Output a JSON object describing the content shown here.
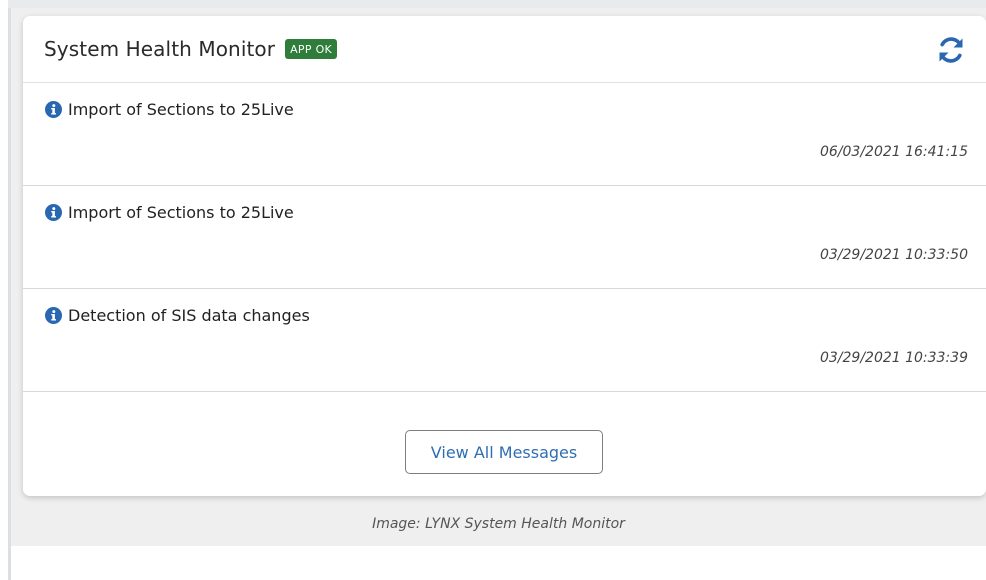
{
  "widget": {
    "title": "System Health Monitor",
    "status_badge": "APP OK",
    "refresh_icon": "refresh-icon"
  },
  "messages": [
    {
      "icon": "info-icon",
      "title": "Import of Sections to 25Live",
      "timestamp": "06/03/2021 16:41:15"
    },
    {
      "icon": "info-icon",
      "title": "Import of Sections to 25Live",
      "timestamp": "03/29/2021 10:33:50"
    },
    {
      "icon": "info-icon",
      "title": "Detection of SIS data changes",
      "timestamp": "03/29/2021 10:33:39"
    }
  ],
  "footer": {
    "view_all_label": "View All Messages"
  },
  "caption": "Image: LYNX System Health Monitor",
  "colors": {
    "badge_bg": "#2e7d3a",
    "accent_blue": "#2f6eb3",
    "info_icon": "#2a67b1"
  }
}
